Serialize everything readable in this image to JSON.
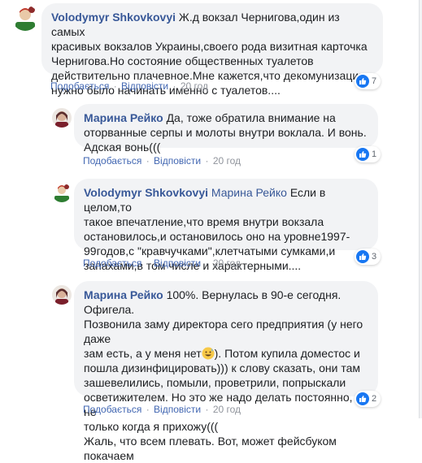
{
  "colors": {
    "link": "#385898",
    "bubble": "#f2f3f5",
    "like_badge": "#1877f2"
  },
  "action_labels": {
    "like": "Подобається",
    "reply": "Відповісти",
    "separator": "·"
  },
  "comments": [
    {
      "author": "Volodymyr Shkovkovyi",
      "mention": "",
      "text_lines": [
        "Ж.д вокзал Чернигова,один из самых",
        "красивых вокзалов Украины,своего рода визитная карточка",
        "Чернигова.Но состояние общественных туалетов",
        "действительно плачевное.Мне кажется,что декомунизацию",
        "нужно было начинать именно с туалетов...."
      ],
      "time": "20 год",
      "reactions": {
        "icon": "like-icon",
        "count": "7"
      }
    },
    {
      "author": "Марина Рейко",
      "mention": "",
      "text_lines": [
        "Да, тоже обратила внимание на",
        "оторванные серпы и молоты внутри воклала. И вонь.",
        "Адская вонь((("
      ],
      "time": "20 год",
      "reactions": {
        "icon": "like-icon",
        "count": "1"
      }
    },
    {
      "author": "Volodymyr Shkovkovyi",
      "mention": "Марина Рейко",
      "text_lines": [
        "Если в целом,то",
        "такое впечатление,что время внутри вокзала",
        "остановилось,и остановилось оно на уровне1997-",
        "99годов,с \"кравчучками\",клетчатыми сумками,и",
        "запахами,в том числе и характерными...."
      ],
      "time": "20 год",
      "reactions": {
        "icon": "like-icon",
        "count": "3"
      }
    },
    {
      "author": "Марина Рейко",
      "mention": "",
      "text_lines": [
        "100%. Вернулась в 90-е сегодня. Офигела.",
        "Позвонила заму директора сего предприятия (у него даже",
        "зам есть, а у меня нет",
        "). Потом купила доместос и",
        "пошла дизинфицировать))) к слову сказать, они там",
        "зашевелились, помыли, проветрили, попрыскали",
        "осветижителем. Но это же надо делать постоянно, а не",
        "только когда я прихожу(((",
        "Жаль, что всем плевать. Вот, может фейсбуком покачаем"
      ],
      "emoji": "grinning-sweat-emoji",
      "time": "20 год",
      "reactions": {
        "icon": "like-icon",
        "count": "2"
      }
    }
  ]
}
